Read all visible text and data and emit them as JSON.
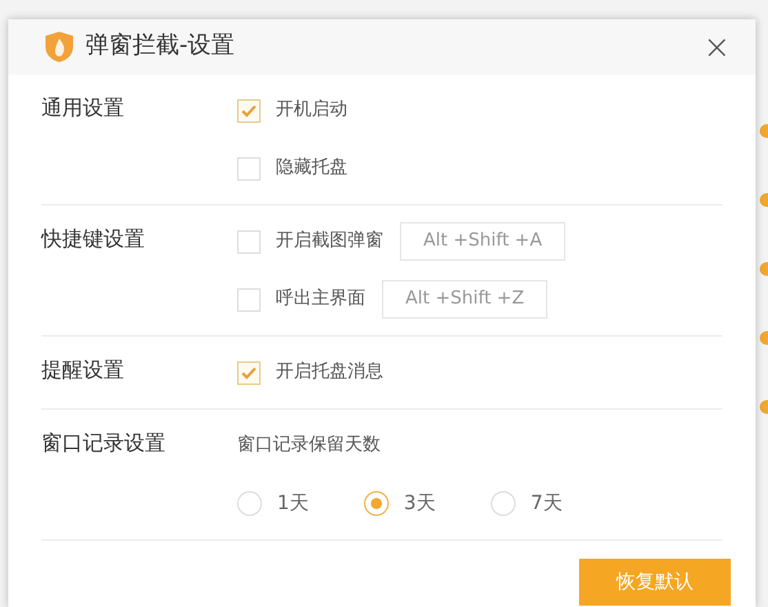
{
  "window": {
    "title": "弹窗拦截-设置",
    "close": "×"
  },
  "sections": [
    {
      "label": "通用设置",
      "items": [
        {
          "kind": "checkbox",
          "label": "开机启动",
          "checked": true
        },
        {
          "kind": "checkbox",
          "label": "隐藏托盘",
          "checked": false
        }
      ]
    },
    {
      "label": "快捷键设置",
      "items": [
        {
          "kind": "checkbox",
          "label": "开启截图弹窗",
          "checked": false,
          "shortcut": "Alt +Shift +A"
        },
        {
          "kind": "checkbox",
          "label": "呼出主界面",
          "checked": false,
          "shortcut": "Alt +Shift +Z"
        }
      ]
    },
    {
      "label": "提醒设置",
      "items": [
        {
          "kind": "checkbox",
          "label": "开启托盘消息",
          "checked": true
        }
      ]
    },
    {
      "label": "窗口记录设置",
      "items": [
        {
          "kind": "text",
          "label": "窗口记录保留天数"
        },
        {
          "kind": "radios",
          "options": [
            {
              "label": "1天",
              "selected": false
            },
            {
              "label": "3天",
              "selected": true
            },
            {
              "label": "7天",
              "selected": false
            }
          ]
        }
      ]
    }
  ],
  "buttons": [
    {
      "label": "恢复默认"
    }
  ]
}
